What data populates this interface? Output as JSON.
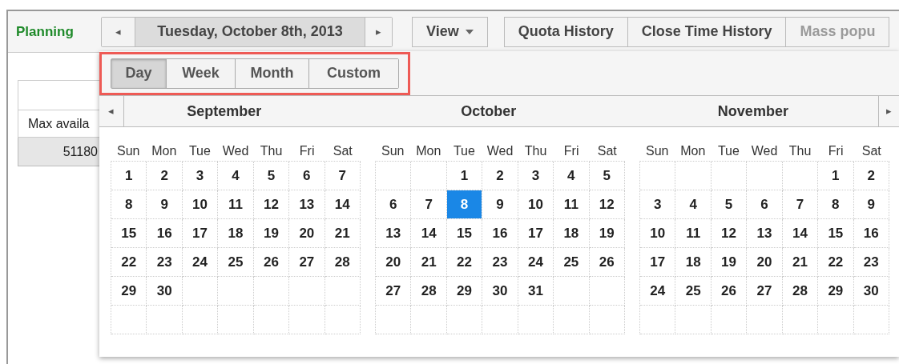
{
  "app_title": "Planning",
  "date_nav": {
    "prev": "◂",
    "label": "Tuesday, October 8th, 2013",
    "next": "▸"
  },
  "toolbar": [
    {
      "label": "View",
      "kind": "menu",
      "disabled": false
    },
    {
      "label": "Quota History",
      "kind": "button",
      "disabled": false
    },
    {
      "label": "Close Time History",
      "kind": "button",
      "disabled": false
    },
    {
      "label": "Mass popu",
      "kind": "button",
      "disabled": true
    }
  ],
  "left_table": {
    "row_label": "Max availa",
    "value": "51180"
  },
  "modes": [
    {
      "label": "Day",
      "selected": true
    },
    {
      "label": "Week",
      "selected": false
    },
    {
      "label": "Month",
      "selected": false
    },
    {
      "label": "Custom",
      "selected": false
    }
  ],
  "calendar": {
    "prev": "◂",
    "next": "▸",
    "months": [
      {
        "name": "September",
        "weekdays": [
          "Sun",
          "Mon",
          "Tue",
          "Wed",
          "Thu",
          "Fri",
          "Sat"
        ],
        "weeks": [
          [
            {
              "kind": "day",
              "text": "1",
              "selected": false
            },
            {
              "kind": "day",
              "text": "2",
              "selected": false
            },
            {
              "kind": "day",
              "text": "3",
              "selected": false
            },
            {
              "kind": "day",
              "text": "4",
              "selected": false
            },
            {
              "kind": "day",
              "text": "5",
              "selected": false
            },
            {
              "kind": "day",
              "text": "6",
              "selected": false
            },
            {
              "kind": "day",
              "text": "7",
              "selected": false
            }
          ],
          [
            {
              "kind": "day",
              "text": "8",
              "selected": false
            },
            {
              "kind": "day",
              "text": "9",
              "selected": false
            },
            {
              "kind": "day",
              "text": "10",
              "selected": false
            },
            {
              "kind": "day",
              "text": "11",
              "selected": false
            },
            {
              "kind": "day",
              "text": "12",
              "selected": false
            },
            {
              "kind": "day",
              "text": "13",
              "selected": false
            },
            {
              "kind": "day",
              "text": "14",
              "selected": false
            }
          ],
          [
            {
              "kind": "day",
              "text": "15",
              "selected": false
            },
            {
              "kind": "day",
              "text": "16",
              "selected": false
            },
            {
              "kind": "day",
              "text": "17",
              "selected": false
            },
            {
              "kind": "day",
              "text": "18",
              "selected": false
            },
            {
              "kind": "day",
              "text": "19",
              "selected": false
            },
            {
              "kind": "day",
              "text": "20",
              "selected": false
            },
            {
              "kind": "day",
              "text": "21",
              "selected": false
            }
          ],
          [
            {
              "kind": "day",
              "text": "22",
              "selected": false
            },
            {
              "kind": "day",
              "text": "23",
              "selected": false
            },
            {
              "kind": "day",
              "text": "24",
              "selected": false
            },
            {
              "kind": "day",
              "text": "25",
              "selected": false
            },
            {
              "kind": "day",
              "text": "26",
              "selected": false
            },
            {
              "kind": "day",
              "text": "27",
              "selected": false
            },
            {
              "kind": "day",
              "text": "28",
              "selected": false
            }
          ],
          [
            {
              "kind": "day",
              "text": "29",
              "selected": false
            },
            {
              "kind": "day",
              "text": "30",
              "selected": false
            },
            {
              "kind": "blank"
            },
            {
              "kind": "blank"
            },
            {
              "kind": "blank"
            },
            {
              "kind": "blank"
            },
            {
              "kind": "blank"
            }
          ],
          [
            {
              "kind": "blank"
            },
            {
              "kind": "blank"
            },
            {
              "kind": "blank"
            },
            {
              "kind": "blank"
            },
            {
              "kind": "blank"
            },
            {
              "kind": "blank"
            },
            {
              "kind": "blank"
            }
          ]
        ]
      },
      {
        "name": "October",
        "weekdays": [
          "Sun",
          "Mon",
          "Tue",
          "Wed",
          "Thu",
          "Fri",
          "Sat"
        ],
        "weeks": [
          [
            {
              "kind": "blank"
            },
            {
              "kind": "blank"
            },
            {
              "kind": "day",
              "text": "1",
              "selected": false
            },
            {
              "kind": "day",
              "text": "2",
              "selected": false
            },
            {
              "kind": "day",
              "text": "3",
              "selected": false
            },
            {
              "kind": "day",
              "text": "4",
              "selected": false
            },
            {
              "kind": "day",
              "text": "5",
              "selected": false
            }
          ],
          [
            {
              "kind": "day",
              "text": "6",
              "selected": false
            },
            {
              "kind": "day",
              "text": "7",
              "selected": false
            },
            {
              "kind": "day",
              "text": "8",
              "selected": true
            },
            {
              "kind": "day",
              "text": "9",
              "selected": false
            },
            {
              "kind": "day",
              "text": "10",
              "selected": false
            },
            {
              "kind": "day",
              "text": "11",
              "selected": false
            },
            {
              "kind": "day",
              "text": "12",
              "selected": false
            }
          ],
          [
            {
              "kind": "day",
              "text": "13",
              "selected": false
            },
            {
              "kind": "day",
              "text": "14",
              "selected": false
            },
            {
              "kind": "day",
              "text": "15",
              "selected": false
            },
            {
              "kind": "day",
              "text": "16",
              "selected": false
            },
            {
              "kind": "day",
              "text": "17",
              "selected": false
            },
            {
              "kind": "day",
              "text": "18",
              "selected": false
            },
            {
              "kind": "day",
              "text": "19",
              "selected": false
            }
          ],
          [
            {
              "kind": "day",
              "text": "20",
              "selected": false
            },
            {
              "kind": "day",
              "text": "21",
              "selected": false
            },
            {
              "kind": "day",
              "text": "22",
              "selected": false
            },
            {
              "kind": "day",
              "text": "23",
              "selected": false
            },
            {
              "kind": "day",
              "text": "24",
              "selected": false
            },
            {
              "kind": "day",
              "text": "25",
              "selected": false
            },
            {
              "kind": "day",
              "text": "26",
              "selected": false
            }
          ],
          [
            {
              "kind": "day",
              "text": "27",
              "selected": false
            },
            {
              "kind": "day",
              "text": "28",
              "selected": false
            },
            {
              "kind": "day",
              "text": "29",
              "selected": false
            },
            {
              "kind": "day",
              "text": "30",
              "selected": false
            },
            {
              "kind": "day",
              "text": "31",
              "selected": false
            },
            {
              "kind": "blank"
            },
            {
              "kind": "blank"
            }
          ],
          [
            {
              "kind": "blank"
            },
            {
              "kind": "blank"
            },
            {
              "kind": "blank"
            },
            {
              "kind": "blank"
            },
            {
              "kind": "blank"
            },
            {
              "kind": "blank"
            },
            {
              "kind": "blank"
            }
          ]
        ]
      },
      {
        "name": "November",
        "weekdays": [
          "Sun",
          "Mon",
          "Tue",
          "Wed",
          "Thu",
          "Fri",
          "Sat"
        ],
        "weeks": [
          [
            {
              "kind": "blank"
            },
            {
              "kind": "blank"
            },
            {
              "kind": "blank"
            },
            {
              "kind": "blank"
            },
            {
              "kind": "blank"
            },
            {
              "kind": "day",
              "text": "1",
              "selected": false
            },
            {
              "kind": "day",
              "text": "2",
              "selected": false
            }
          ],
          [
            {
              "kind": "day",
              "text": "3",
              "selected": false
            },
            {
              "kind": "day",
              "text": "4",
              "selected": false
            },
            {
              "kind": "day",
              "text": "5",
              "selected": false
            },
            {
              "kind": "day",
              "text": "6",
              "selected": false
            },
            {
              "kind": "day",
              "text": "7",
              "selected": false
            },
            {
              "kind": "day",
              "text": "8",
              "selected": false
            },
            {
              "kind": "day",
              "text": "9",
              "selected": false
            }
          ],
          [
            {
              "kind": "day",
              "text": "10",
              "selected": false
            },
            {
              "kind": "day",
              "text": "11",
              "selected": false
            },
            {
              "kind": "day",
              "text": "12",
              "selected": false
            },
            {
              "kind": "day",
              "text": "13",
              "selected": false
            },
            {
              "kind": "day",
              "text": "14",
              "selected": false
            },
            {
              "kind": "day",
              "text": "15",
              "selected": false
            },
            {
              "kind": "day",
              "text": "16",
              "selected": false
            }
          ],
          [
            {
              "kind": "day",
              "text": "17",
              "selected": false
            },
            {
              "kind": "day",
              "text": "18",
              "selected": false
            },
            {
              "kind": "day",
              "text": "19",
              "selected": false
            },
            {
              "kind": "day",
              "text": "20",
              "selected": false
            },
            {
              "kind": "day",
              "text": "21",
              "selected": false
            },
            {
              "kind": "day",
              "text": "22",
              "selected": false
            },
            {
              "kind": "day",
              "text": "23",
              "selected": false
            }
          ],
          [
            {
              "kind": "day",
              "text": "24",
              "selected": false
            },
            {
              "kind": "day",
              "text": "25",
              "selected": false
            },
            {
              "kind": "day",
              "text": "26",
              "selected": false
            },
            {
              "kind": "day",
              "text": "27",
              "selected": false
            },
            {
              "kind": "day",
              "text": "28",
              "selected": false
            },
            {
              "kind": "day",
              "text": "29",
              "selected": false
            },
            {
              "kind": "day",
              "text": "30",
              "selected": false
            }
          ],
          [
            {
              "kind": "blank"
            },
            {
              "kind": "blank"
            },
            {
              "kind": "blank"
            },
            {
              "kind": "blank"
            },
            {
              "kind": "blank"
            },
            {
              "kind": "blank"
            },
            {
              "kind": "blank"
            }
          ]
        ]
      }
    ]
  }
}
